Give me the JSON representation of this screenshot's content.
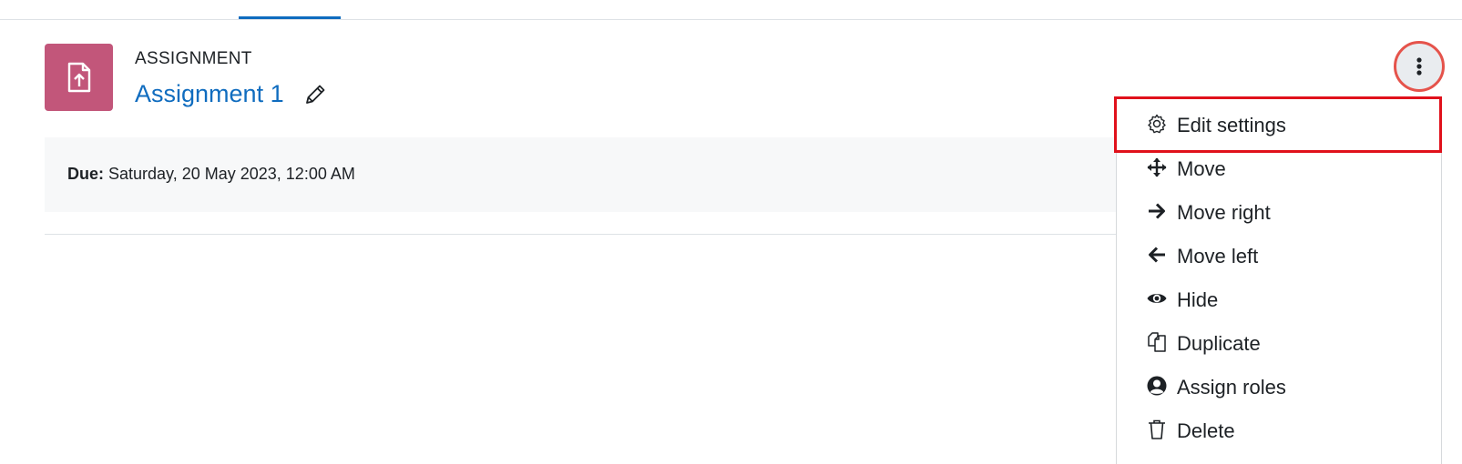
{
  "activity": {
    "type_label": "ASSIGNMENT",
    "title": "Assignment 1",
    "icon": "assignment-upload-icon",
    "icon_color": "#c2567a"
  },
  "dates": {
    "due_label": "Due:",
    "due_value": "Saturday, 20 May 2023, 12:00 AM"
  },
  "actions_button": {
    "icon": "kebab-vertical-icon",
    "highlight_color": "#e5534b"
  },
  "menu": {
    "highlight_color": "#e0111b",
    "items": [
      {
        "label": "Edit settings",
        "icon": "gear-icon"
      },
      {
        "label": "Move",
        "icon": "move-arrows-icon"
      },
      {
        "label": "Move right",
        "icon": "arrow-right-icon"
      },
      {
        "label": "Move left",
        "icon": "arrow-left-icon"
      },
      {
        "label": "Hide",
        "icon": "eye-icon"
      },
      {
        "label": "Duplicate",
        "icon": "copy-icon"
      },
      {
        "label": "Assign roles",
        "icon": "user-circle-icon"
      },
      {
        "label": "Delete",
        "icon": "trash-icon"
      }
    ]
  },
  "colors": {
    "link": "#0f6cbf",
    "text": "#1d2125"
  }
}
